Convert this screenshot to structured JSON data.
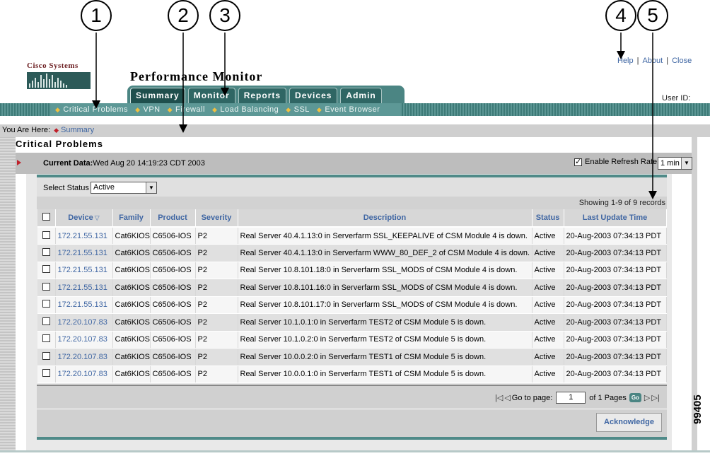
{
  "callouts": [
    "1",
    "2",
    "3",
    "4",
    "5"
  ],
  "brand": {
    "name": "Cisco Systems",
    "logo_icon": "cisco-bridge-logo-icon"
  },
  "app_title": "Performance Monitor",
  "top_links": {
    "help": "Help",
    "about": "About",
    "close": "Close",
    "separator": "|"
  },
  "tabs": [
    {
      "label": "Summary",
      "active": true
    },
    {
      "label": "Monitor",
      "active": false
    },
    {
      "label": "Reports",
      "active": false
    },
    {
      "label": "Devices",
      "active": false
    },
    {
      "label": "Admin",
      "active": false
    }
  ],
  "user_id_label": "User ID:",
  "subnav": [
    {
      "label": "Critical Problems"
    },
    {
      "label": "VPN"
    },
    {
      "label": "Firewall"
    },
    {
      "label": "Load Balancing"
    },
    {
      "label": "SSL"
    },
    {
      "label": "Event Browser"
    }
  ],
  "breadcrumb": {
    "prefix": "You Are Here:",
    "current": "Summary"
  },
  "section_title": "Critical Problems",
  "current_data": {
    "label": "Current Data:",
    "value": "Wed Aug 20 14:19:23 CDT 2003"
  },
  "refresh": {
    "label": "Enable Refresh Rate",
    "checked": true,
    "rate": "1 min"
  },
  "status_filter": {
    "label": "Select Status",
    "value": "Active"
  },
  "records_summary": "Showing 1-9 of 9 records",
  "columns": [
    "",
    "Device",
    "Family",
    "Product",
    "Severity",
    "Description",
    "Status",
    "Last Update Time"
  ],
  "rows": [
    {
      "device": "172.21.55.131",
      "family": "Cat6KIOS",
      "product": "C6506-IOS",
      "severity": "P2",
      "description": "Real Server 40.4.1.13:0 in Serverfarm SSL_KEEPALIVE of CSM Module 4 is down.",
      "status": "Active",
      "time": "20-Aug-2003 07:34:13 PDT"
    },
    {
      "device": "172.21.55.131",
      "family": "Cat6KIOS",
      "product": "C6506-IOS",
      "severity": "P2",
      "description": "Real Server 40.4.1.13:0 in Serverfarm WWW_80_DEF_2 of CSM Module 4 is down.",
      "status": "Active",
      "time": "20-Aug-2003 07:34:13 PDT"
    },
    {
      "device": "172.21.55.131",
      "family": "Cat6KIOS",
      "product": "C6506-IOS",
      "severity": "P2",
      "description": "Real Server 10.8.101.18:0 in Serverfarm SSL_MODS of CSM Module 4 is down.",
      "status": "Active",
      "time": "20-Aug-2003 07:34:13 PDT"
    },
    {
      "device": "172.21.55.131",
      "family": "Cat6KIOS",
      "product": "C6506-IOS",
      "severity": "P2",
      "description": "Real Server 10.8.101.16:0 in Serverfarm SSL_MODS of CSM Module 4 is down.",
      "status": "Active",
      "time": "20-Aug-2003 07:34:13 PDT"
    },
    {
      "device": "172.21.55.131",
      "family": "Cat6KIOS",
      "product": "C6506-IOS",
      "severity": "P2",
      "description": "Real Server 10.8.101.17:0 in Serverfarm SSL_MODS of CSM Module 4 is down.",
      "status": "Active",
      "time": "20-Aug-2003 07:34:13 PDT"
    },
    {
      "device": "172.20.107.83",
      "family": "Cat6KIOS",
      "product": "C6506-IOS",
      "severity": "P2",
      "description": "Real Server 10.1.0.1:0 in Serverfarm TEST2 of CSM Module 5 is down.",
      "status": "Active",
      "time": "20-Aug-2003 07:34:13 PDT"
    },
    {
      "device": "172.20.107.83",
      "family": "Cat6KIOS",
      "product": "C6506-IOS",
      "severity": "P2",
      "description": "Real Server 10.1.0.2:0 in Serverfarm TEST2 of CSM Module 5 is down.",
      "status": "Active",
      "time": "20-Aug-2003 07:34:13 PDT"
    },
    {
      "device": "172.20.107.83",
      "family": "Cat6KIOS",
      "product": "C6506-IOS",
      "severity": "P2",
      "description": "Real Server 10.0.0.2:0 in Serverfarm TEST1 of CSM Module 5 is down.",
      "status": "Active",
      "time": "20-Aug-2003 07:34:13 PDT"
    },
    {
      "device": "172.20.107.83",
      "family": "Cat6KIOS",
      "product": "C6506-IOS",
      "severity": "P2",
      "description": "Real Server 10.0.0.1:0 in Serverfarm TEST1 of CSM Module 5 is down.",
      "status": "Active",
      "time": "20-Aug-2003 07:34:13 PDT"
    }
  ],
  "pager": {
    "goto_label": "Go to page:",
    "page": "1",
    "of_label": "of 1 Pages",
    "go": "Go"
  },
  "acknowledge": "Acknowledge",
  "figure_id": "99405",
  "colors": {
    "teal": "#4b8583",
    "link": "#3f66a3",
    "accent_red": "#c0202a"
  }
}
